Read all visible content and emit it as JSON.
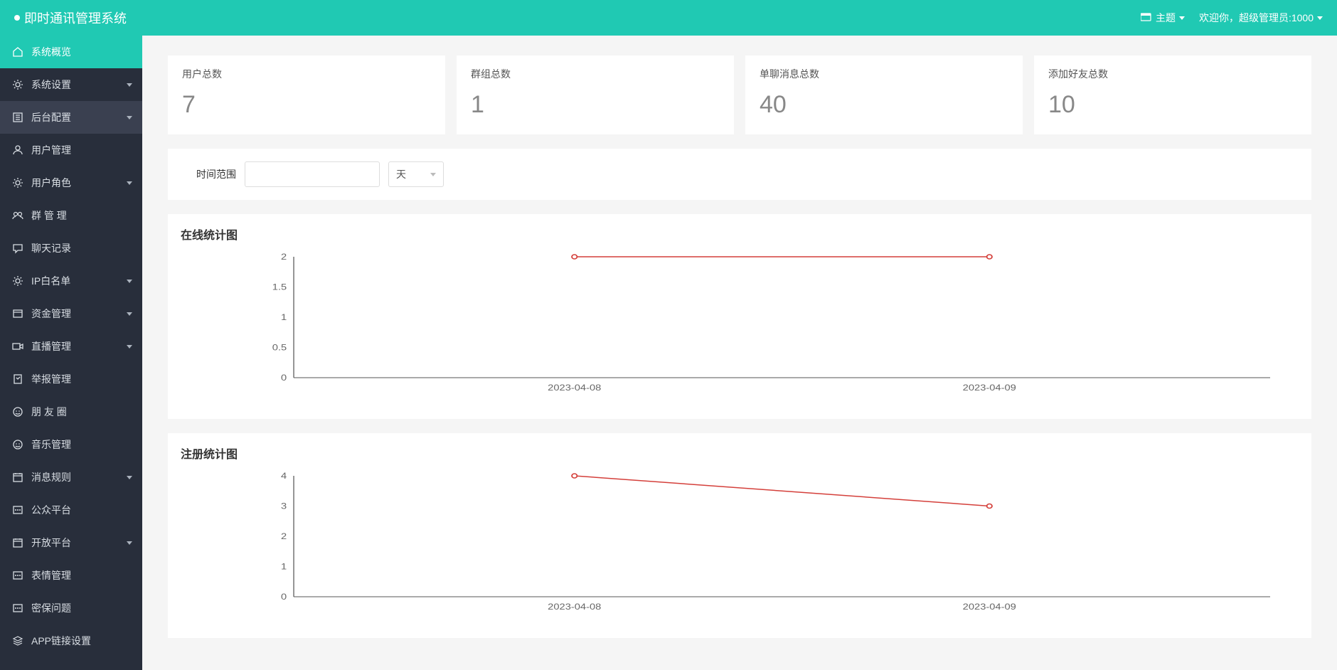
{
  "header": {
    "title": "即时通讯管理系统",
    "theme_label": "主题",
    "welcome_text": "欢迎你，超级管理员:1000"
  },
  "sidebar": {
    "items": [
      {
        "label": "系统概览",
        "icon": "home",
        "active": true,
        "expandable": false
      },
      {
        "label": "系统设置",
        "icon": "gear",
        "expandable": true
      },
      {
        "label": "后台配置",
        "icon": "config",
        "highlighted": true,
        "expandable": true
      },
      {
        "label": "用户管理",
        "icon": "user",
        "expandable": false
      },
      {
        "label": "用户角色",
        "icon": "gear",
        "expandable": true
      },
      {
        "label": "群 管 理",
        "icon": "group",
        "expandable": false
      },
      {
        "label": "聊天记录",
        "icon": "chat",
        "expandable": false
      },
      {
        "label": "IP白名单",
        "icon": "gear",
        "expandable": true
      },
      {
        "label": "资金管理",
        "icon": "money",
        "expandable": true
      },
      {
        "label": "直播管理",
        "icon": "video",
        "expandable": true
      },
      {
        "label": "举报管理",
        "icon": "report",
        "expandable": false
      },
      {
        "label": "朋 友 圈",
        "icon": "smile",
        "expandable": false
      },
      {
        "label": "音乐管理",
        "icon": "smile",
        "expandable": false
      },
      {
        "label": "消息规则",
        "icon": "calendar",
        "expandable": true
      },
      {
        "label": "公众平台",
        "icon": "platform",
        "expandable": false
      },
      {
        "label": "开放平台",
        "icon": "calendar",
        "expandable": true
      },
      {
        "label": "表情管理",
        "icon": "platform",
        "expandable": false
      },
      {
        "label": "密保问题",
        "icon": "platform",
        "expandable": false
      },
      {
        "label": "APP链接设置",
        "icon": "layers",
        "expandable": false
      }
    ]
  },
  "stats": [
    {
      "label": "用户总数",
      "value": "7"
    },
    {
      "label": "群组总数",
      "value": "1"
    },
    {
      "label": "单聊消息总数",
      "value": "40"
    },
    {
      "label": "添加好友总数",
      "value": "10"
    }
  ],
  "filter": {
    "label": "时间范围",
    "select_value": "天"
  },
  "chart_data": [
    {
      "type": "line",
      "title": "在线统计图",
      "categories": [
        "2023-04-08",
        "2023-04-09"
      ],
      "values": [
        2,
        2
      ],
      "ylim": [
        0,
        2
      ],
      "yticks": [
        0,
        0.5,
        1,
        1.5,
        2
      ]
    },
    {
      "type": "line",
      "title": "注册统计图",
      "categories": [
        "2023-04-08",
        "2023-04-09"
      ],
      "values": [
        4,
        3
      ],
      "ylim": [
        0,
        4
      ],
      "yticks": [
        0,
        1,
        2,
        3,
        4
      ]
    }
  ]
}
